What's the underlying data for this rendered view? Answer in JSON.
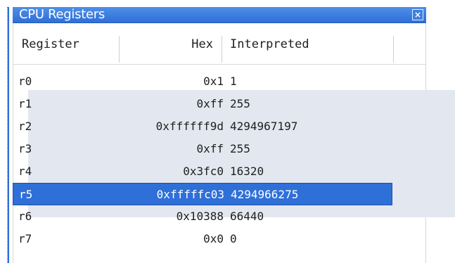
{
  "window": {
    "title": "CPU Registers",
    "close_label": "×"
  },
  "table": {
    "columns": [
      {
        "label": "Register"
      },
      {
        "label": "Hex"
      },
      {
        "label": "Interpreted"
      }
    ],
    "rows": [
      {
        "register": "r0",
        "hex": "0x1",
        "interpreted": "1"
      },
      {
        "register": "r1",
        "hex": "0xff",
        "interpreted": "255"
      },
      {
        "register": "r2",
        "hex": "0xffffff9d",
        "interpreted": "4294967197"
      },
      {
        "register": "r3",
        "hex": "0xff",
        "interpreted": "255"
      },
      {
        "register": "r4",
        "hex": "0x3fc0",
        "interpreted": "16320"
      },
      {
        "register": "r5",
        "hex": "0xfffffc03",
        "interpreted": "4294966275",
        "selected": true
      },
      {
        "register": "r6",
        "hex": "0x10388",
        "interpreted": "66440"
      },
      {
        "register": "r7",
        "hex": "0x0",
        "interpreted": "0"
      }
    ]
  },
  "colors": {
    "titlebar": "#2f6fd8",
    "selection": "#2f6fd8",
    "highlight": "#e3e8f0"
  }
}
